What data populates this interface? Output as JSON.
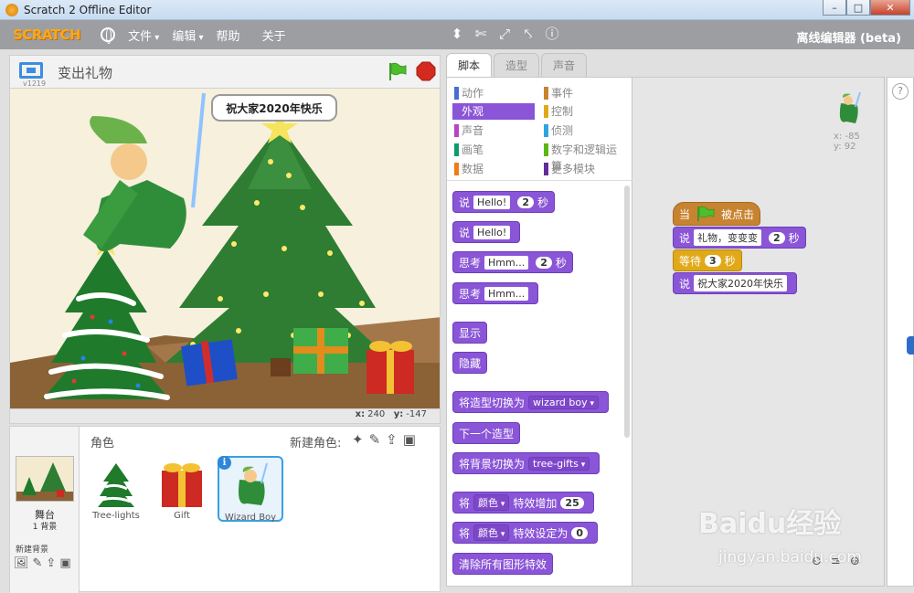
{
  "window": {
    "title": "Scratch 2 Offline Editor",
    "min": "–",
    "max": "□",
    "close": "✕"
  },
  "menubar": {
    "logo": "SCRATCH",
    "file": "文件",
    "edit": "编辑",
    "help": "帮助",
    "about": "关于",
    "mode": "离线编辑器 (beta)"
  },
  "stage": {
    "title": "变出礼物",
    "version": "v1219",
    "speech": "祝大家2020年快乐",
    "x_label": "x:",
    "x_value": "240",
    "y_label": "y:",
    "y_value": "-147"
  },
  "sprites": {
    "title": "角色",
    "new_sprite": "新建角色:",
    "stage_label": "舞台",
    "backdrop_count": "1 背景",
    "new_backdrop": "新建背景",
    "items": [
      {
        "name": "Tree-lights"
      },
      {
        "name": "Gift"
      },
      {
        "name": "Wizard Boy"
      }
    ]
  },
  "tabs": [
    "脚本",
    "造型",
    "声音"
  ],
  "categories": [
    {
      "label": "动作",
      "color": "#4a6cd4"
    },
    {
      "label": "事件",
      "color": "#c88330"
    },
    {
      "label": "外观",
      "color": "#8a55d7"
    },
    {
      "label": "控制",
      "color": "#e1a91a"
    },
    {
      "label": "声音",
      "color": "#bb42c3"
    },
    {
      "label": "侦测",
      "color": "#2ca5e2"
    },
    {
      "label": "画笔",
      "color": "#0e9a6c"
    },
    {
      "label": "数字和逻辑运算",
      "color": "#5cb712"
    },
    {
      "label": "数据",
      "color": "#ee7d16"
    },
    {
      "label": "更多模块",
      "color": "#632d99"
    }
  ],
  "palette": {
    "say": "说",
    "hello": "Hello!",
    "secs": "秒",
    "two": "2",
    "think": "思考",
    "hmm": "Hmm...",
    "show": "显示",
    "hide": "隐藏",
    "switch_costume": "将造型切换为",
    "costume": "wizard boy",
    "next_costume": "下一个造型",
    "switch_backdrop": "将背景切换为",
    "backdrop": "tree-gifts",
    "change": "将",
    "effect": "颜色",
    "change_by": "特效增加",
    "change_value": "25",
    "set_to": "特效设定为",
    "set_value": "0",
    "clear": "清除所有图形特效"
  },
  "script": {
    "when": "当",
    "clicked": "被点击",
    "say1": "说",
    "text1": "礼物，变变变",
    "secs1": "2",
    "sec": "秒",
    "wait": "等待",
    "wait_value": "3",
    "say2": "说",
    "text2": "祝大家2020年快乐"
  },
  "sprite_info": {
    "x": "x: -85",
    "y": "y: 92"
  },
  "help": "?",
  "watermark": {
    "brand": "Baidu经验",
    "url": "jingyan.baidu.com"
  }
}
